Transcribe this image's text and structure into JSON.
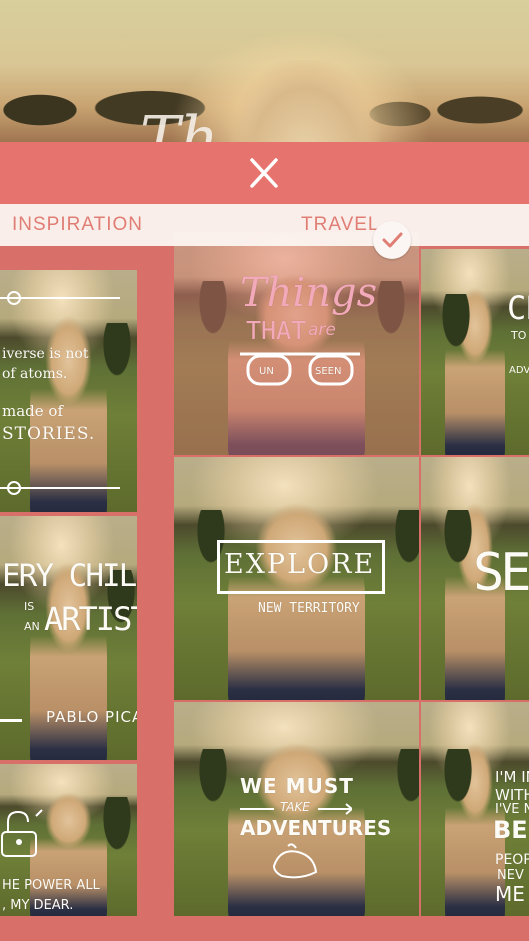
{
  "close_icon": "close-icon",
  "tabs": [
    {
      "label": "INSPIRATION",
      "selected": false
    },
    {
      "label": "TRAVEL",
      "selected": true
    }
  ],
  "colors": {
    "accent": "#e6736d",
    "overlay": "#d87069",
    "tab_text": "#e07d74",
    "tab_bar": "#fcf4f1"
  },
  "inspiration_cards": [
    {
      "lines": [
        "iverse is not",
        "of atoms.",
        "made of",
        "STORIES."
      ]
    },
    {
      "lines": [
        "ERY CHILD",
        "IS",
        "AN",
        "ARTIST",
        "PABLO PICASO"
      ]
    },
    {
      "lines": [
        "HE POWER ALL",
        ", MY DEAR."
      ]
    }
  ],
  "travel_cards": [
    {
      "lines": [
        "Things",
        "THAT",
        "are",
        "UN",
        "SEEN"
      ],
      "selected": true
    },
    {
      "lines": [
        "CH",
        "TO",
        "ADV"
      ]
    },
    {
      "lines": [
        "EXPLORE",
        "NEW TERRITORY"
      ]
    },
    {
      "lines": [
        "SEE"
      ]
    },
    {
      "lines": [
        "WE MUST",
        "TAKE",
        "ADVENTURES"
      ]
    },
    {
      "lines": [
        "I'M IN",
        "WITH",
        "I'VE NE",
        "BEEN",
        "PEOP",
        "NEV",
        "ME"
      ]
    }
  ]
}
